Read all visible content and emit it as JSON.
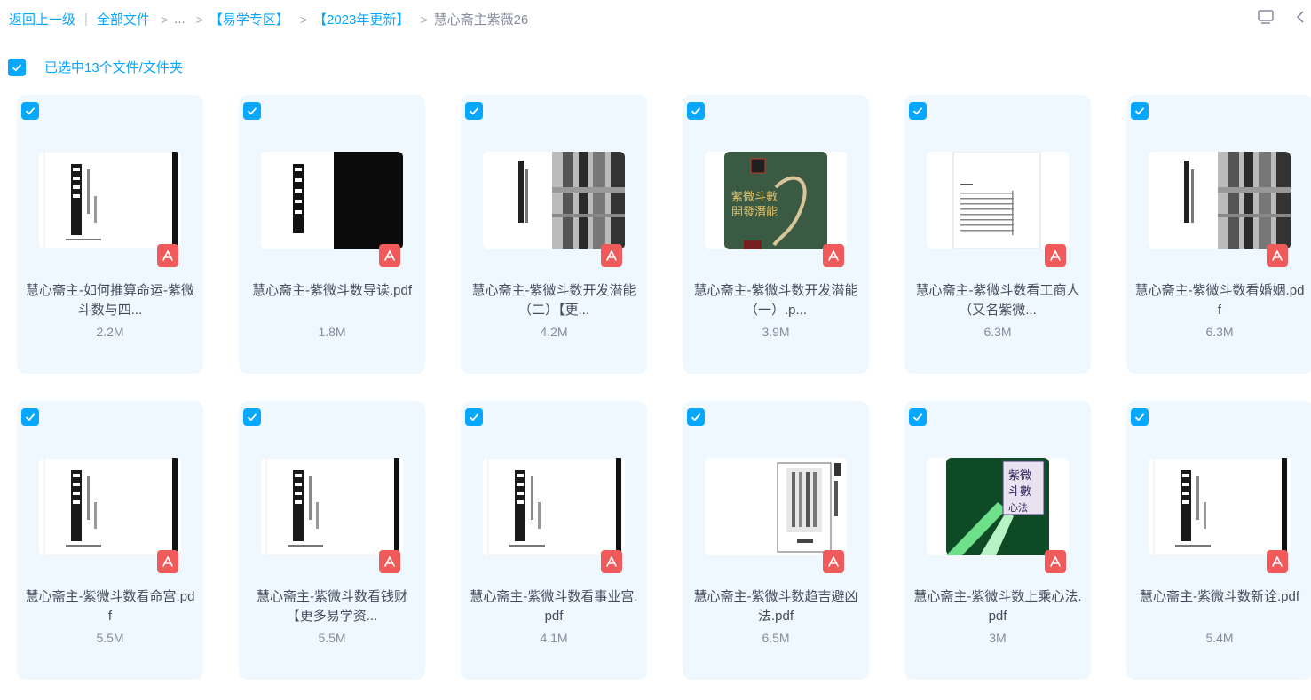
{
  "breadcrumb": {
    "back": "返回上一级",
    "all_files": "全部文件",
    "ellipsis": "...",
    "folder1": "【易学专区】",
    "folder2": "【2023年更新】",
    "current": "慧心斋主紫薇26"
  },
  "toolbar": {
    "view_icon": "monitor-icon",
    "collapse_icon": "chevron-left-icon"
  },
  "selection": {
    "text": "已选中13个文件/文件夹",
    "checked": true
  },
  "colors": {
    "accent": "#06a7ff",
    "card_bg": "#eef8fe",
    "pdf_badge": "#f05a5a"
  },
  "files": [
    {
      "name": "慧心斋主-如何推算命运-紫微斗数与四...",
      "size": "2.2M",
      "checked": true,
      "thumb": "scan-doc",
      "icon": "pdf-icon"
    },
    {
      "name": "慧心斋主-紫微斗数导读.pdf",
      "size": "1.8M",
      "checked": true,
      "thumb": "dark-spread",
      "icon": "pdf-icon"
    },
    {
      "name": "慧心斋主-紫微斗数开发潜能（二）【更...",
      "size": "4.2M",
      "checked": true,
      "thumb": "noisy-spread",
      "icon": "pdf-icon"
    },
    {
      "name": "慧心斋主-紫微斗数开发潜能（一）.p...",
      "size": "3.9M",
      "checked": true,
      "thumb": "green-cover",
      "icon": "pdf-icon"
    },
    {
      "name": "慧心斋主-紫微斗数看工商人（又名紫微...",
      "size": "6.3M",
      "checked": true,
      "thumb": "toc-page",
      "icon": "pdf-icon"
    },
    {
      "name": "慧心斋主-紫微斗数看婚姻.pdf",
      "size": "6.3M",
      "checked": true,
      "thumb": "noisy-spread",
      "icon": "pdf-icon"
    },
    {
      "name": "慧心斋主-紫微斗数看命宫.pdf",
      "size": "5.5M",
      "checked": true,
      "thumb": "scan-doc",
      "icon": "pdf-icon"
    },
    {
      "name": "慧心斋主-紫微斗数看钱财【更多易学资...",
      "size": "5.5M",
      "checked": true,
      "thumb": "scan-doc",
      "icon": "pdf-icon"
    },
    {
      "name": "慧心斋主-紫微斗数看事业宫.pdf",
      "size": "4.1M",
      "checked": true,
      "thumb": "scan-doc",
      "icon": "pdf-icon"
    },
    {
      "name": "慧心斋主-紫微斗数趋吉避凶法.pdf",
      "size": "6.5M",
      "checked": true,
      "thumb": "calligraphy",
      "icon": "pdf-icon"
    },
    {
      "name": "慧心斋主-紫微斗数上乘心法.pdf",
      "size": "3M",
      "checked": true,
      "thumb": "green-light-cover",
      "icon": "pdf-icon"
    },
    {
      "name": "慧心斋主-紫微斗数新诠.pdf",
      "size": "5.4M",
      "checked": true,
      "thumb": "scan-doc",
      "icon": "pdf-icon"
    }
  ]
}
